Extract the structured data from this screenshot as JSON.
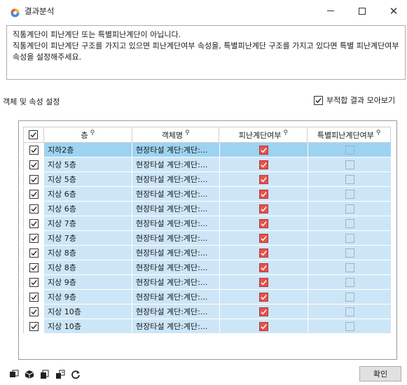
{
  "window": {
    "title": "결과분석",
    "minimize_icon": "minimize-icon",
    "maximize_icon": "maximize-icon",
    "close_label": "✕"
  },
  "message": {
    "line1": "직통계단이 피난계단 또는 특별피난계단이 아닙니다.",
    "line2": "직통계단이 피난계단 구조를 가지고 있으면 피난계단여부 속성을, 특별피난계단 구조를 가지고 있다면 특별 피난계단여부 속성을 설정해주세요."
  },
  "section_label": "객체 및 속성 설정",
  "merge_view": {
    "label": "부적합 결과 모아보기",
    "checked": true
  },
  "grid": {
    "columns": [
      "층",
      "객체명",
      "피난계단여부",
      "특별피난계단여부"
    ],
    "rows": [
      {
        "checked": true,
        "floor": "지하2층",
        "object": "현장타설 계단:계단:...",
        "evac": true,
        "special": false,
        "selected": true
      },
      {
        "checked": true,
        "floor": "지상 5층",
        "object": "현장타설 계단:계단:...",
        "evac": true,
        "special": false
      },
      {
        "checked": true,
        "floor": "지상 5층",
        "object": "현장타설 계단:계단:...",
        "evac": true,
        "special": false
      },
      {
        "checked": true,
        "floor": "지상 6층",
        "object": "현장타설 계단:계단:...",
        "evac": true,
        "special": false
      },
      {
        "checked": true,
        "floor": "지상 6층",
        "object": "현장타설 계단:계단:...",
        "evac": true,
        "special": false
      },
      {
        "checked": true,
        "floor": "지상 7층",
        "object": "현장타설 계단:계단:...",
        "evac": true,
        "special": false
      },
      {
        "checked": true,
        "floor": "지상 7층",
        "object": "현장타설 계단:계단:...",
        "evac": true,
        "special": false
      },
      {
        "checked": true,
        "floor": "지상 8층",
        "object": "현장타설 계단:계단:...",
        "evac": true,
        "special": false
      },
      {
        "checked": true,
        "floor": "지상 8층",
        "object": "현장타설 계단:계단:...",
        "evac": true,
        "special": false
      },
      {
        "checked": true,
        "floor": "지상 9층",
        "object": "현장타설 계단:계단:...",
        "evac": true,
        "special": false
      },
      {
        "checked": true,
        "floor": "지상 9층",
        "object": "현장타설 계단:계단:...",
        "evac": true,
        "special": false
      },
      {
        "checked": true,
        "floor": "지상 10층",
        "object": "현장타설 계단:계단:...",
        "evac": true,
        "special": false
      },
      {
        "checked": true,
        "floor": "지상 10층",
        "object": "현장타설 계단:계단:...",
        "evac": true,
        "special": false
      }
    ]
  },
  "toolbar": {
    "icons": [
      "select-object-icon",
      "cube-icon",
      "copy-icon",
      "export-icon",
      "refresh-icon"
    ]
  },
  "ok_button": "확인",
  "colors": {
    "row_bg": "#cde6f7",
    "row_selected": "#9dd3f1",
    "evac_checked": "#e8504b"
  }
}
